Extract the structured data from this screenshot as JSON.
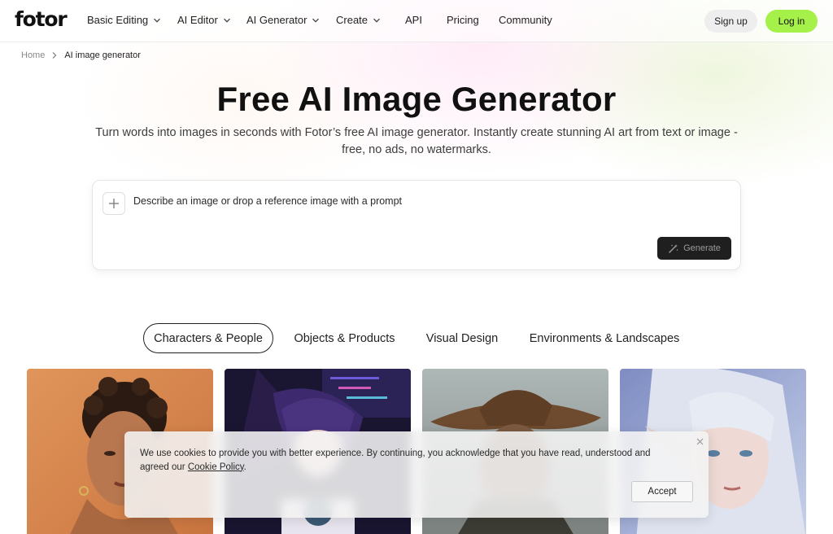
{
  "header": {
    "logo": "fotor",
    "nav": [
      {
        "label": "Basic Editing",
        "has_dropdown": true
      },
      {
        "label": "AI Editor",
        "has_dropdown": true
      },
      {
        "label": "AI Generator",
        "has_dropdown": true
      },
      {
        "label": "Create",
        "has_dropdown": true
      },
      {
        "label": "API",
        "has_dropdown": false
      },
      {
        "label": "Pricing",
        "has_dropdown": false
      },
      {
        "label": "Community",
        "has_dropdown": false
      }
    ],
    "signup_label": "Sign up",
    "login_label": "Log in"
  },
  "breadcrumb": {
    "home": "Home",
    "current": "AI image generator"
  },
  "hero": {
    "title": "Free AI Image Generator",
    "subtitle": "Turn words into images in seconds with Fotor’s free AI image generator. Instantly create stunning AI art from text or image - free, no ads, no watermarks."
  },
  "prompt": {
    "placeholder": "Describe an image or drop a reference image with a prompt",
    "value": "",
    "generate_label": "Generate"
  },
  "tabs": [
    {
      "label": "Characters & People",
      "active": true
    },
    {
      "label": "Objects & Products",
      "active": false
    },
    {
      "label": "Visual Design",
      "active": false
    },
    {
      "label": "Environments & Landscapes",
      "active": false
    }
  ],
  "gallery": [
    {
      "name": "woman-curly-hair-portrait"
    },
    {
      "name": "anime-character-neon"
    },
    {
      "name": "man-cowboy-hat"
    },
    {
      "name": "elf-woman-silver-hair"
    }
  ],
  "cookie": {
    "text_before": "We use cookies to provide you with better experience. By continuing, you acknowledge that you have read, understood and agreed our ",
    "link": "Cookie Policy",
    "text_after": ".",
    "accept_label": "Accept"
  },
  "colors": {
    "login_green": "#a6f04a",
    "generate_bg": "#1f1f1f",
    "signup_bg": "#eeeeee"
  }
}
